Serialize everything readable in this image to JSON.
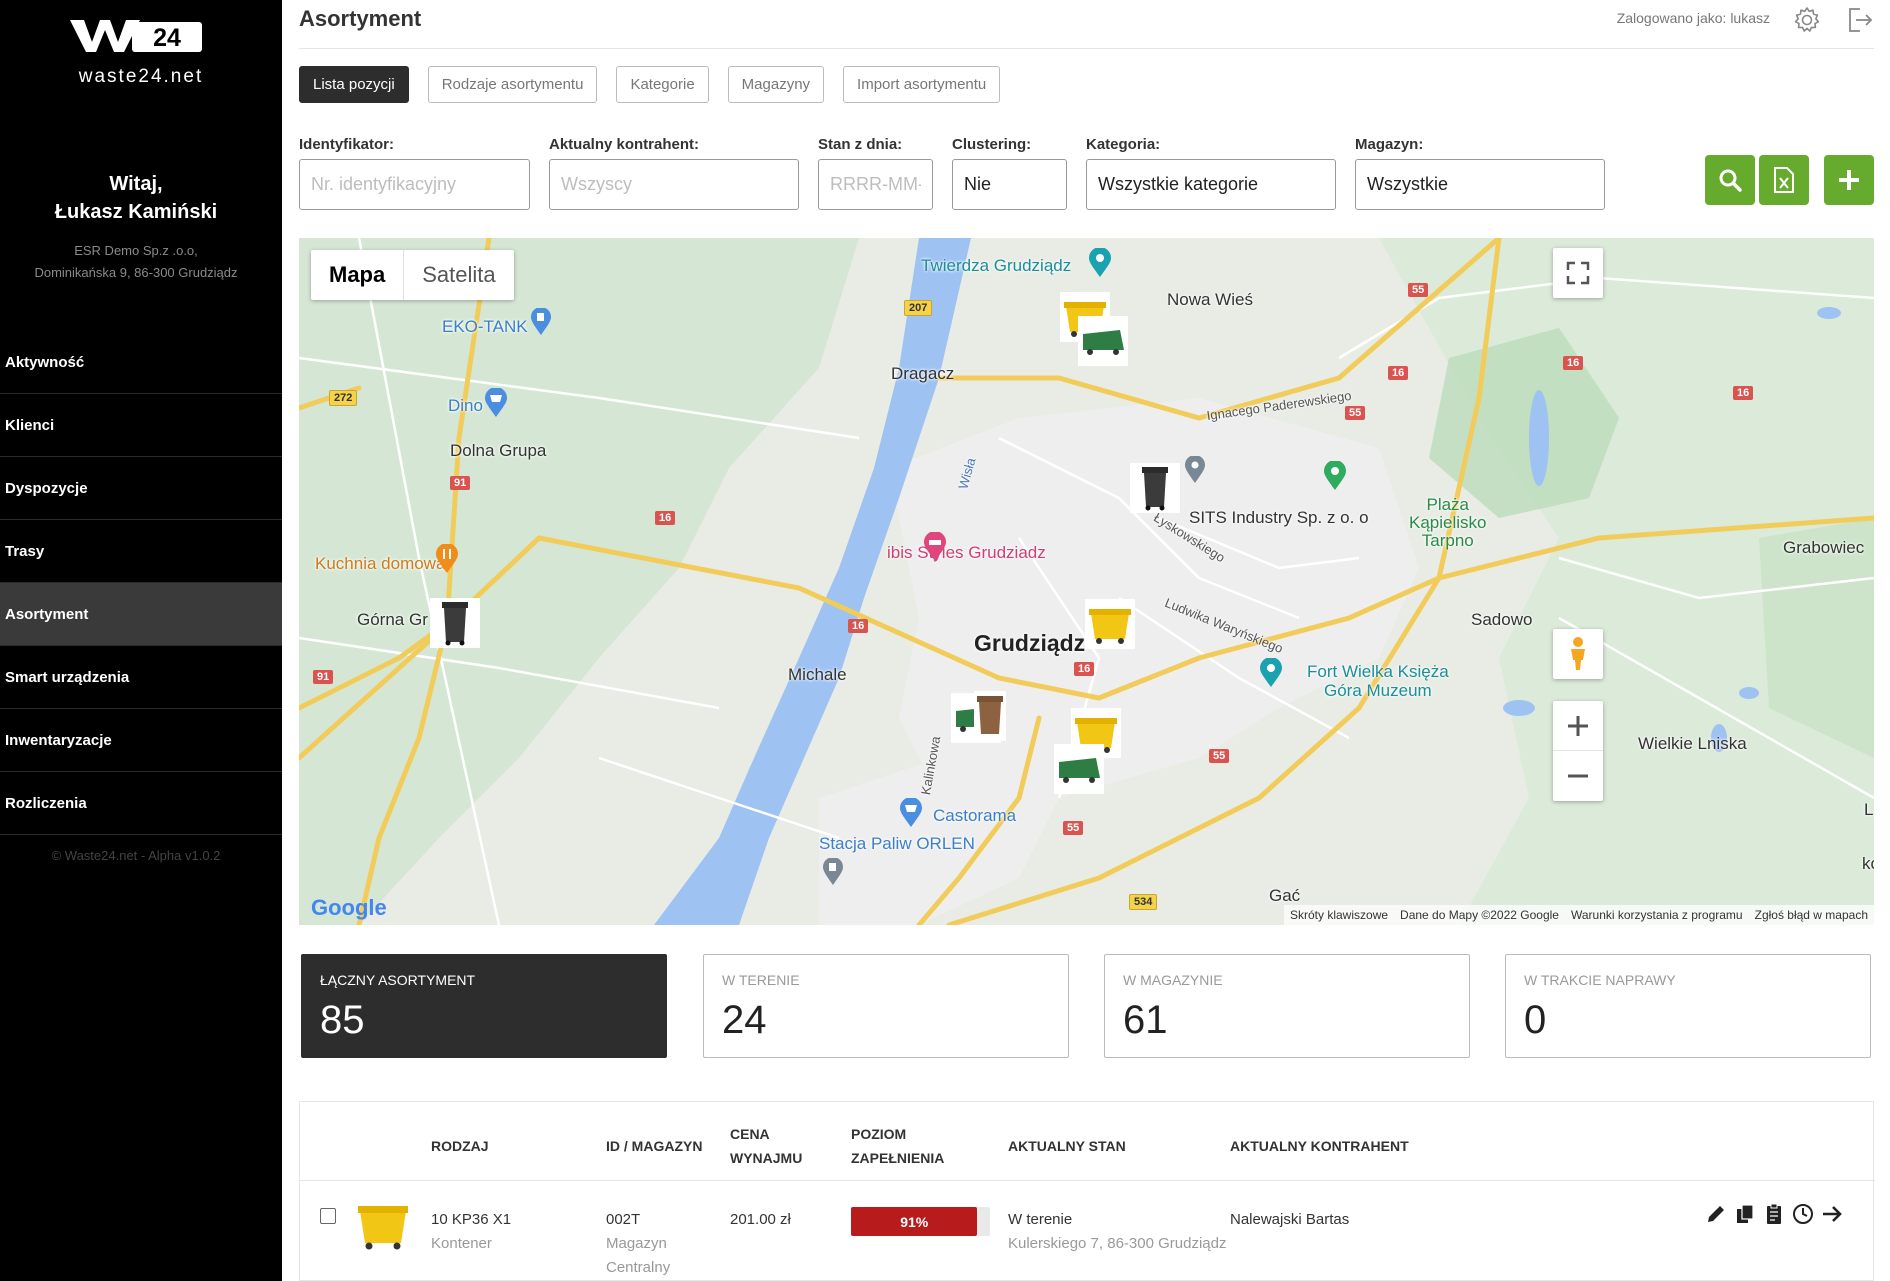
{
  "sidebar": {
    "logo_text": "waste24.net",
    "welcome_line1": "Witaj,",
    "welcome_line2": "Łukasz Kamiński",
    "company_line1": "ESR Demo Sp.z .o.o,",
    "company_line2": "Dominikańska 9, 86-300 Grudziądz",
    "items": [
      {
        "label": "Aktywność"
      },
      {
        "label": "Klienci"
      },
      {
        "label": "Dyspozycje"
      },
      {
        "label": "Trasy"
      },
      {
        "label": "Asortyment",
        "active": true
      },
      {
        "label": "Smart urządzenia"
      },
      {
        "label": "Inwentaryzacje"
      },
      {
        "label": "Rozliczenia"
      }
    ],
    "copyright": "© Waste24.net - Alpha v1.0.2"
  },
  "header": {
    "title": "Asortyment",
    "logged_as": "Zalogowano jako: lukasz",
    "settings_icon": "gear-icon",
    "logout_icon": "logout-icon"
  },
  "tabs": [
    {
      "label": "Lista pozycji",
      "active": true
    },
    {
      "label": "Rodzaje asortymentu"
    },
    {
      "label": "Kategorie"
    },
    {
      "label": "Magazyny"
    },
    {
      "label": "Import asortymentu"
    }
  ],
  "filters": {
    "identyfikator": {
      "label": "Identyfikator:",
      "placeholder": "Nr. identyfikacyjny",
      "value": ""
    },
    "kontrahent": {
      "label": "Aktualny kontrahent:",
      "placeholder": "Wszyscy",
      "value": ""
    },
    "stan": {
      "label": "Stan z dnia:",
      "placeholder": "RRRR-MM-DD",
      "value": ""
    },
    "clustering": {
      "label": "Clustering:",
      "value": "Nie"
    },
    "kategoria": {
      "label": "Kategoria:",
      "value": "Wszystkie kategorie"
    },
    "magazyn": {
      "label": "Magazyn:",
      "value": "Wszystkie"
    },
    "accent": "#67ab2e"
  },
  "map": {
    "type_buttons": [
      "Mapa",
      "Satelita"
    ],
    "active_type": "Mapa",
    "labels": {
      "twierdza": "Twierdza Grudziądz",
      "nowa_wies": "Nowa Wieś",
      "eko_tank": "EKO-TANK",
      "dragacz": "Dragacz",
      "dino": "Dino",
      "dolna_grupa": "Dolna Grupa",
      "paderewskiego": "Ignacego Paderewskiego",
      "wisla": "Wisła",
      "sits": "SITS Industry Sp. z o. o",
      "plaza_1": "Plaża",
      "plaza_2": "Kąpielisko",
      "plaza_3": "Tarpno",
      "grabowiec": "Grabowiec",
      "kuchnia": "Kuchnia domowa",
      "ibis": "ibis Styles Grudziadz",
      "lyskowskiego": "Łyskowskiego",
      "gorna_grupa": "Górna Gr",
      "grudziadz": "Grudziądz",
      "warynskiego": "Ludwika Waryńskiego",
      "sadowo": "Sadowo",
      "michale": "Michale",
      "fort_1": "Fort Wielka Księża",
      "fort_2": "Góra Muzeum",
      "wielkie_lniska": "Wielkie Lniska",
      "kalinkowa": "Kalinkowa",
      "castorama": "Castorama",
      "orlen": "Stacja Paliw ORLEN",
      "gac": "Gać",
      "edge_l": "L",
      "edge_kc": "kc"
    },
    "roads": [
      "207",
      "55",
      "272",
      "16",
      "16",
      "16",
      "55",
      "91",
      "16",
      "16",
      "91",
      "55",
      "55",
      "534",
      "534"
    ],
    "google": "Google",
    "attribution": [
      "Skróty klawiszowe",
      "Dane do Mapy ©2022 Google",
      "Warunki korzystania z programu",
      "Zgłoś błąd w mapach"
    ]
  },
  "stats": [
    {
      "label": "ŁĄCZNY ASORTYMENT",
      "value": "85",
      "dark": true
    },
    {
      "label": "W TERENIE",
      "value": "24"
    },
    {
      "label": "W MAGAZYNIE",
      "value": "61"
    },
    {
      "label": "W TRAKCIE NAPRAWY",
      "value": "0"
    }
  ],
  "table": {
    "headers": {
      "rodzaj": "RODZAJ",
      "id": "ID / MAGAZYN",
      "cena_1": "CENA",
      "cena_2": "WYNAJMU",
      "poziom_1": "POZIOM",
      "poziom_2": "ZAPEŁNIENIA",
      "stan": "AKTUALNY STAN",
      "kontrahent": "AKTUALNY KONTRAHENT"
    },
    "rows": [
      {
        "rodzaj": "10 KP36 X1",
        "typ": "Kontener",
        "id": "002T",
        "magazyn_1": "Magazyn",
        "magazyn_2": "Centralny",
        "cena": "201.00 zł",
        "fill_percent": 91,
        "fill_label": "91%",
        "stan": "W terenie",
        "adres": "Kulerskiego 7, 86-300 Grudziądz",
        "kontrahent": "Nalewajski Bartas",
        "fill_color": "#b81b1b"
      }
    ],
    "action_icons": [
      "pencil-icon",
      "copy-icon",
      "clipboard-icon",
      "clock-icon",
      "arrow-right-icon"
    ]
  }
}
